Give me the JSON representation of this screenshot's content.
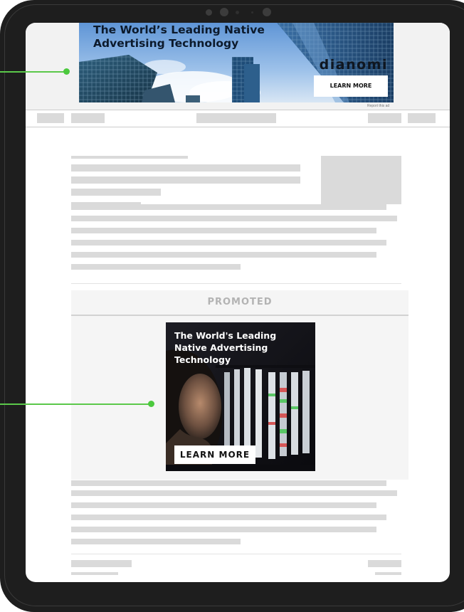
{
  "top_ad": {
    "headline": "The World’s Leading Native Advertising Technology",
    "brand": "Dianomi",
    "cta": "LEARN MORE",
    "report_link": "Report this ad"
  },
  "promoted": {
    "label": "PROMOTED",
    "ad_headline": "The World's Leading Native Advertising Technology",
    "cta": "LEARN MORE"
  },
  "colors": {
    "callout": "#4cc93e",
    "placeholder": "#dadada",
    "device": "#1e1e1e"
  }
}
